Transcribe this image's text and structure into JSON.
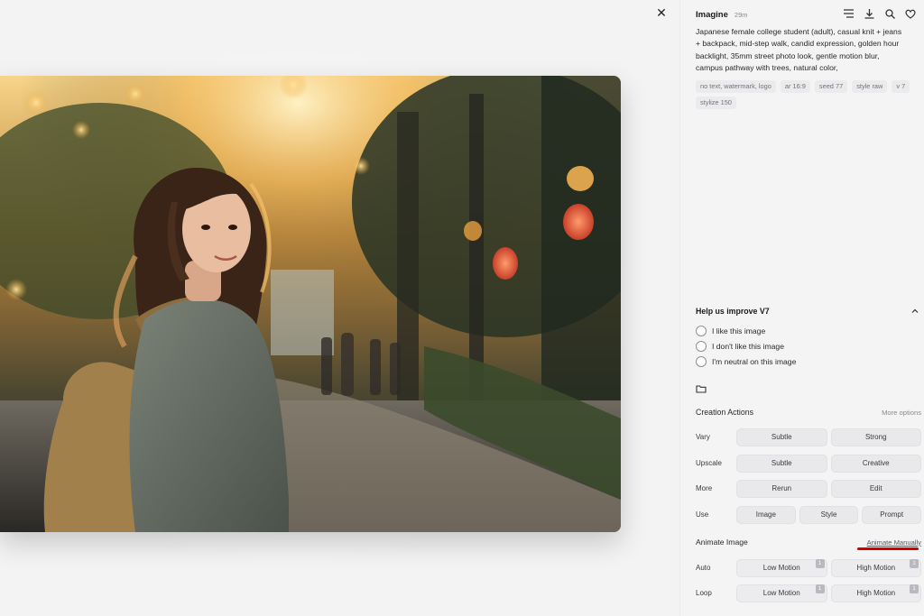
{
  "viewer": {
    "close_glyph": "✕"
  },
  "panel": {
    "title": "Imagine",
    "time": "29m",
    "icons": [
      "list-icon",
      "download-icon",
      "search-icon",
      "heart-icon"
    ],
    "prompt": "Japanese female college student (adult), casual knit + jeans + backpack, mid-step walk, candid expression, golden hour backlight, 35mm street photo look, gentle motion blur, campus pathway with trees, natural color,",
    "tags": [
      "no text, watermark, logo",
      "ar 16:9",
      "seed 77",
      "style raw",
      "v 7",
      "stylize 150"
    ]
  },
  "feedback": {
    "title": "Help us improve V7",
    "options": [
      "I like this image",
      "I don't like this image",
      "I'm neutral on this image"
    ]
  },
  "creation": {
    "title": "Creation Actions",
    "more": "More options",
    "rows": [
      {
        "label": "Vary",
        "buttons": [
          "Subtle",
          "Strong"
        ]
      },
      {
        "label": "Upscale",
        "buttons": [
          "Subtle",
          "Creative"
        ]
      },
      {
        "label": "More",
        "buttons": [
          "Rerun",
          "Edit"
        ]
      },
      {
        "label": "Use",
        "buttons": [
          "Image",
          "Style",
          "Prompt"
        ]
      }
    ]
  },
  "animate": {
    "title": "Animate Image",
    "manual": "Animate Manually",
    "rows": [
      {
        "label": "Auto",
        "buttons": [
          "Low Motion",
          "High Motion"
        ],
        "badges": [
          "1",
          "1"
        ]
      },
      {
        "label": "Loop",
        "buttons": [
          "Low Motion",
          "High Motion"
        ],
        "badges": [
          "1",
          "1"
        ]
      }
    ]
  },
  "colors": {
    "accent_red": "#d40000",
    "panel_bg": "#f4f4f5"
  }
}
